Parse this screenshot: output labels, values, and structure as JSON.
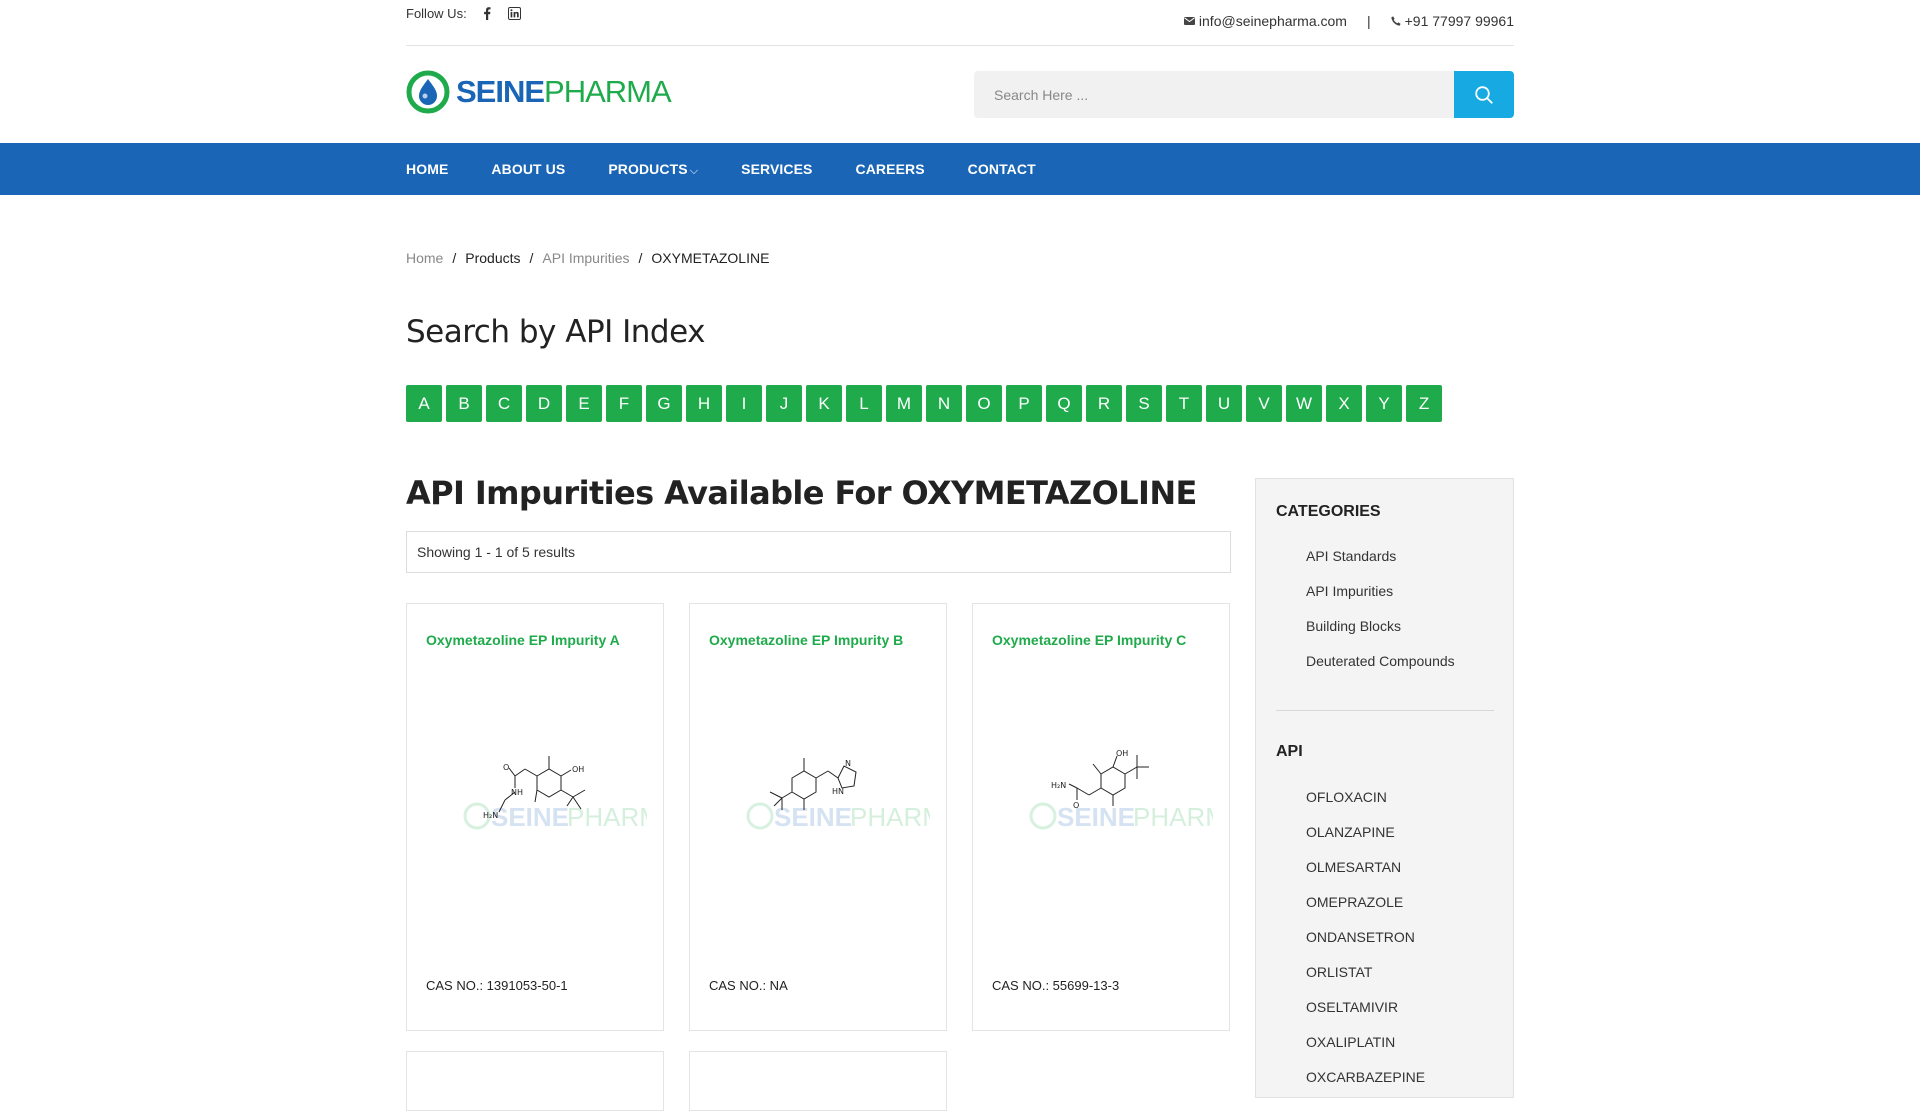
{
  "topbar": {
    "follow_label": "Follow Us:",
    "social": [
      {
        "icon": "facebook-icon"
      },
      {
        "icon": "linkedin-icon"
      }
    ],
    "email": "info@seinepharma.com",
    "separator": "|",
    "phone": "+91 77997 99961"
  },
  "header": {
    "logo_primary": "SEINE",
    "logo_secondary": "PHARMA",
    "search_placeholder": "Search Here ...",
    "search_icon": "search-icon"
  },
  "nav": {
    "items": [
      "HOME",
      "ABOUT US",
      "PRODUCTS",
      "SERVICES",
      "CAREERS",
      "CONTACT"
    ],
    "products_chevron": "⌵"
  },
  "breadcrumb": {
    "items": [
      "Home",
      "Products",
      "API Impurities",
      "OXYMETAZOLINE"
    ],
    "separator": "/"
  },
  "index": {
    "title": "Search by API Index",
    "letters": [
      "A",
      "B",
      "C",
      "D",
      "E",
      "F",
      "G",
      "H",
      "I",
      "J",
      "K",
      "L",
      "M",
      "N",
      "O",
      "P",
      "Q",
      "R",
      "S",
      "T",
      "U",
      "V",
      "W",
      "X",
      "Y",
      "Z"
    ]
  },
  "main": {
    "title": "API Impurities Available For OXYMETAZOLINE",
    "results": "Showing 1 - 1 of 5 results",
    "products": [
      {
        "name": "Oxymetazoline EP Impurity A",
        "cas": "CAS NO.: 1391053-50-1"
      },
      {
        "name": "Oxymetazoline EP Impurity B",
        "cas": "CAS NO.: NA"
      },
      {
        "name": "Oxymetazoline EP Impurity C",
        "cas": "CAS NO.: 55699-13-3"
      }
    ]
  },
  "sidebar": {
    "categories_title": "CATEGORIES",
    "categories": [
      "API Standards",
      "API Impurities",
      "Building Blocks",
      "Deuterated Compounds"
    ],
    "api_title": "API",
    "apis": [
      "OFLOXACIN",
      "OLANZAPINE",
      "OLMESARTAN",
      "OMEPRAZOLE",
      "ONDANSETRON",
      "ORLISTAT",
      "OSELTAMIVIR",
      "OXALIPLATIN",
      "OXCARBAZEPINE"
    ]
  },
  "colors": {
    "brand_blue": "#1a65b5",
    "brand_green": "#1faa4b",
    "search_blue": "#17a9e1"
  }
}
